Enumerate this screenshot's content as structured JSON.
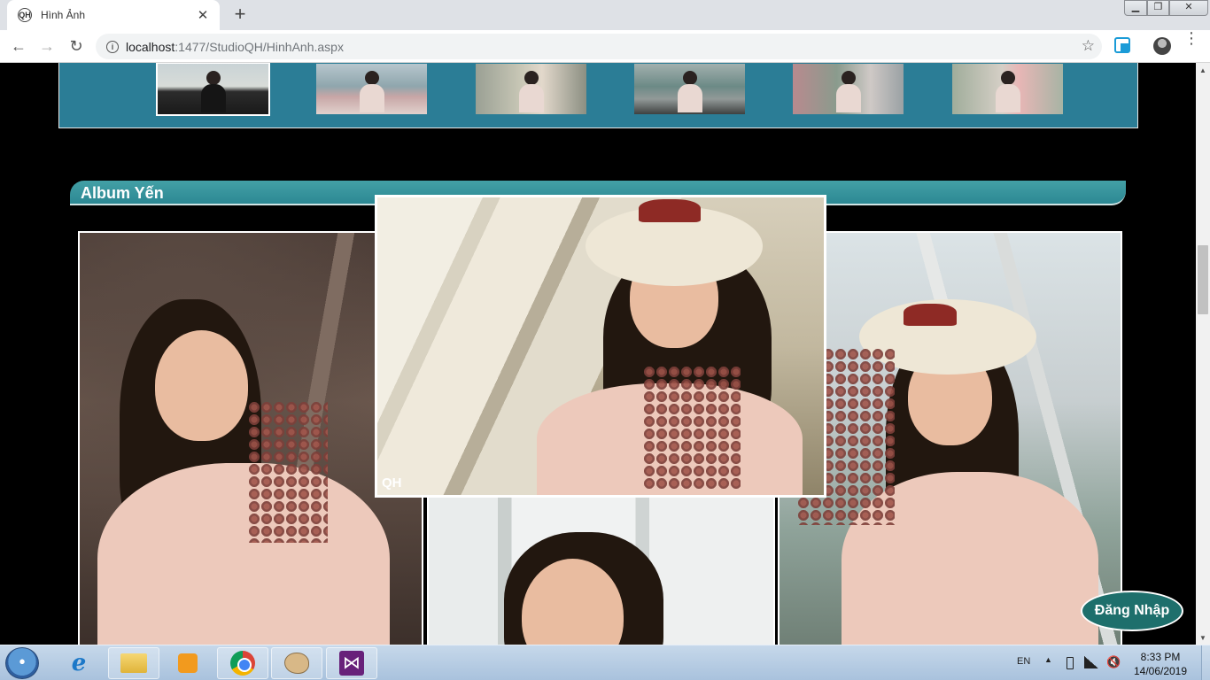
{
  "browser": {
    "tab_title": "Hình Ảnh",
    "favicon_text": "QH",
    "tab_close": "✕",
    "new_tab": "+",
    "url_host": "localhost",
    "url_rest": ":1477/StudioQH/HinhAnh.aspx",
    "window_min": "▁",
    "window_max": "❐",
    "window_close": "✕",
    "nav_back": "←",
    "nav_forward": "→",
    "nav_reload": "↻",
    "info_icon": "i",
    "star_icon": "☆",
    "menu_icon": "⋮"
  },
  "page": {
    "album_title": "Album Yến",
    "center_logo": "QH",
    "login_button": "Đăng Nhập",
    "thumbnails": [
      {
        "name": "thumb-1",
        "active": true
      },
      {
        "name": "thumb-2",
        "active": false
      },
      {
        "name": "thumb-3",
        "active": false
      },
      {
        "name": "thumb-4",
        "active": false
      },
      {
        "name": "thumb-5",
        "active": false
      },
      {
        "name": "thumb-6",
        "active": false
      }
    ],
    "colors": {
      "strip_bg": "#2b7d96",
      "album_header": "#3a9aa0",
      "login_bg": "#1e6f6c"
    }
  },
  "taskbar": {
    "lang": "EN",
    "tray_arrow": "▲",
    "volume_icon": "🔇",
    "time": "8:33 PM",
    "date": "14/06/2019",
    "ie_label": "e",
    "vs_label": "⋈",
    "pinned_apps": [
      "internet-explorer",
      "file-explorer",
      "media-player",
      "chrome",
      "paint",
      "visual-studio"
    ]
  }
}
